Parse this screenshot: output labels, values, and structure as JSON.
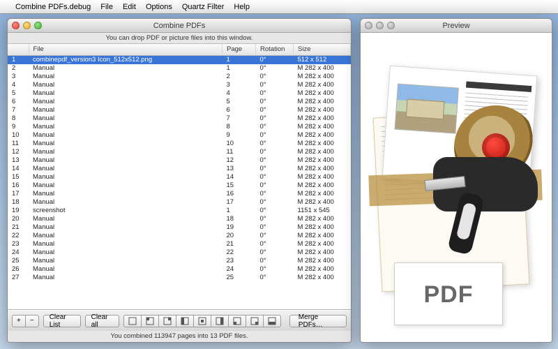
{
  "menubar": {
    "items": [
      "Combine PDFs.debug",
      "File",
      "Edit",
      "Options",
      "Quartz Filter",
      "Help"
    ]
  },
  "main_window": {
    "title": "Combine PDFs",
    "hint": "You can drop PDF or picture files into this window.",
    "columns": {
      "idx": "",
      "file": "File",
      "page": "Page",
      "rotation": "Rotation",
      "size": "Size"
    },
    "rows": [
      {
        "idx": 1,
        "file": "combinepdf_version3 Icon_512x512.png",
        "page": 1,
        "rotation": "0°",
        "size": "512 x 512",
        "selected": true
      },
      {
        "idx": 2,
        "file": "Manual",
        "page": 1,
        "rotation": "0°",
        "size": "M 282 x 400"
      },
      {
        "idx": 3,
        "file": "Manual",
        "page": 2,
        "rotation": "0°",
        "size": "M 282 x 400"
      },
      {
        "idx": 4,
        "file": "Manual",
        "page": 3,
        "rotation": "0°",
        "size": "M 282 x 400"
      },
      {
        "idx": 5,
        "file": "Manual",
        "page": 4,
        "rotation": "0°",
        "size": "M 282 x 400"
      },
      {
        "idx": 6,
        "file": "Manual",
        "page": 5,
        "rotation": "0°",
        "size": "M 282 x 400"
      },
      {
        "idx": 7,
        "file": "Manual",
        "page": 6,
        "rotation": "0°",
        "size": "M 282 x 400"
      },
      {
        "idx": 8,
        "file": "Manual",
        "page": 7,
        "rotation": "0°",
        "size": "M 282 x 400"
      },
      {
        "idx": 9,
        "file": "Manual",
        "page": 8,
        "rotation": "0°",
        "size": "M 282 x 400"
      },
      {
        "idx": 10,
        "file": "Manual",
        "page": 9,
        "rotation": "0°",
        "size": "M 282 x 400"
      },
      {
        "idx": 11,
        "file": "Manual",
        "page": 10,
        "rotation": "0°",
        "size": "M 282 x 400"
      },
      {
        "idx": 12,
        "file": "Manual",
        "page": 11,
        "rotation": "0°",
        "size": "M 282 x 400"
      },
      {
        "idx": 13,
        "file": "Manual",
        "page": 12,
        "rotation": "0°",
        "size": "M 282 x 400"
      },
      {
        "idx": 14,
        "file": "Manual",
        "page": 13,
        "rotation": "0°",
        "size": "M 282 x 400"
      },
      {
        "idx": 15,
        "file": "Manual",
        "page": 14,
        "rotation": "0°",
        "size": "M 282 x 400"
      },
      {
        "idx": 16,
        "file": "Manual",
        "page": 15,
        "rotation": "0°",
        "size": "M 282 x 400"
      },
      {
        "idx": 17,
        "file": "Manual",
        "page": 16,
        "rotation": "0°",
        "size": "M 282 x 400"
      },
      {
        "idx": 18,
        "file": "Manual",
        "page": 17,
        "rotation": "0°",
        "size": "M 282 x 400"
      },
      {
        "idx": 19,
        "file": "screenshot",
        "page": 1,
        "rotation": "0°",
        "size": "1151 x 545"
      },
      {
        "idx": 20,
        "file": "Manual",
        "page": 18,
        "rotation": "0°",
        "size": "M 282 x 400"
      },
      {
        "idx": 21,
        "file": "Manual",
        "page": 19,
        "rotation": "0°",
        "size": "M 282 x 400"
      },
      {
        "idx": 22,
        "file": "Manual",
        "page": 20,
        "rotation": "0°",
        "size": "M 282 x 400"
      },
      {
        "idx": 23,
        "file": "Manual",
        "page": 21,
        "rotation": "0°",
        "size": "M 282 x 400"
      },
      {
        "idx": 24,
        "file": "Manual",
        "page": 22,
        "rotation": "0°",
        "size": "M 282 x 400"
      },
      {
        "idx": 25,
        "file": "Manual",
        "page": 23,
        "rotation": "0°",
        "size": "M 282 x 400"
      },
      {
        "idx": 26,
        "file": "Manual",
        "page": 24,
        "rotation": "0°",
        "size": "M 282 x 400"
      },
      {
        "idx": 27,
        "file": "Manual",
        "page": 25,
        "rotation": "0°",
        "size": "M 282 x 400"
      }
    ],
    "toolbar": {
      "add": "+",
      "remove": "−",
      "clear_list": "Clear List",
      "clear_all": "Clear all",
      "merge": "Merge PDFs…"
    },
    "status": "You combined 113947 pages into 13 PDF files."
  },
  "preview_window": {
    "title": "Preview",
    "pdf_label": "PDF"
  }
}
